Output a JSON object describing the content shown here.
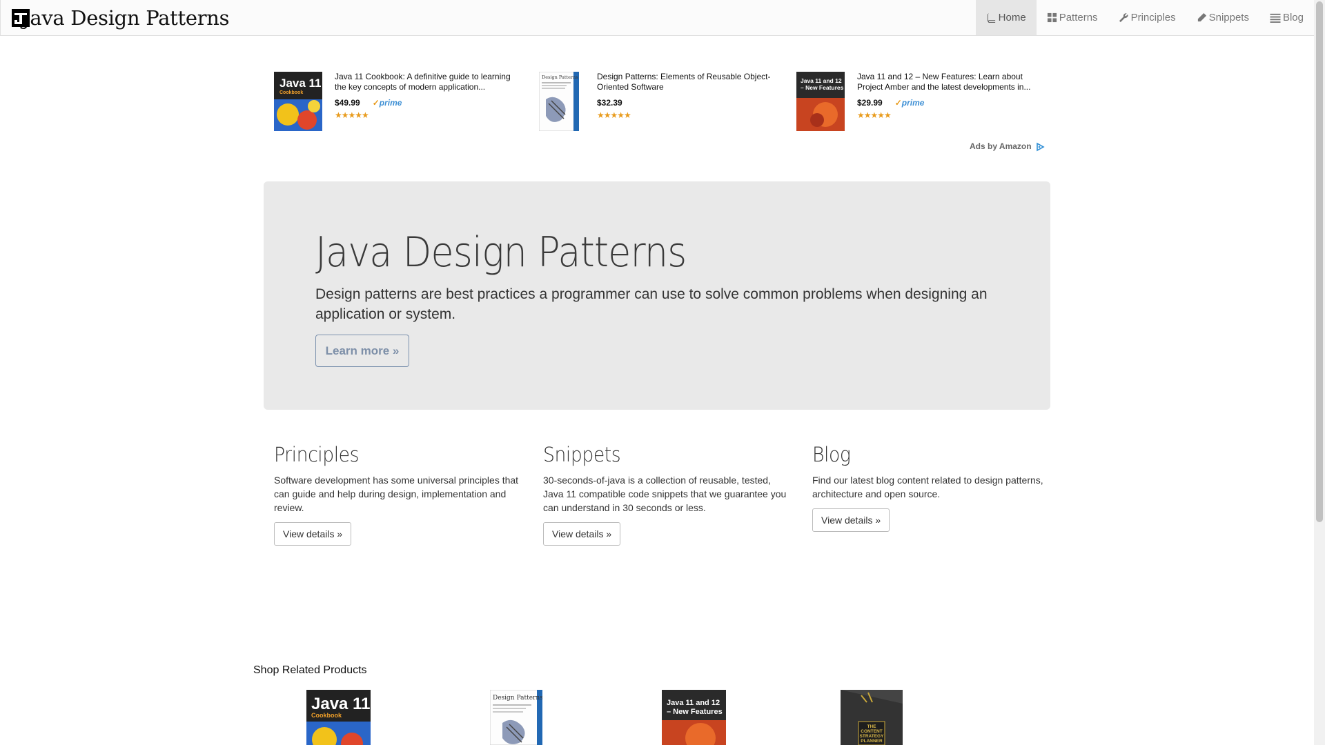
{
  "brand": {
    "title": "Java Design Patterns"
  },
  "nav": {
    "items": [
      {
        "label": "Home",
        "icon": "book-icon"
      },
      {
        "label": "Patterns",
        "icon": "grid-icon"
      },
      {
        "label": "Principles",
        "icon": "wrench-icon"
      },
      {
        "label": "Snippets",
        "icon": "pencil-icon"
      },
      {
        "label": "Blog",
        "icon": "list-icon"
      }
    ]
  },
  "ads": {
    "items": [
      {
        "cover_title": "Java 11",
        "cover_subtitle": "Cookbook",
        "title": "Java 11 Cookbook: A definitive guide to learning the key concepts of modern application...",
        "price": "$49.99",
        "prime": "prime",
        "rating": "★★★★★"
      },
      {
        "cover_title": "Design Patterns",
        "title": "Design Patterns: Elements of Reusable Object-Oriented Software",
        "price": "$32.39",
        "rating": "★★★★★"
      },
      {
        "cover_title": "Java 11 and 12",
        "cover_subtitle": "– New Features",
        "title": "Java 11 and 12 – New Features: Learn about Project Amber and the latest developments in...",
        "price": "$29.99",
        "prime": "prime",
        "rating": "★★★★★"
      }
    ],
    "ads_by": "Ads by Amazon"
  },
  "jumbotron": {
    "title": "Java Design Patterns",
    "text": "Design patterns are best practices a programmer can use to solve common problems when designing an application or system.",
    "button": "Learn more »"
  },
  "columns": [
    {
      "heading": "Principles",
      "text": "Software development has some universal principles that can guide and help during design, implementation and review.",
      "button": "View details »"
    },
    {
      "heading": "Snippets",
      "text": "30-seconds-of-java is a collection of reusable, tested, Java 11 compatible code snippets that we guarantee you can understand in 30 seconds or less.",
      "button": "View details »"
    },
    {
      "heading": "Blog",
      "text": "Find our latest blog content related to design patterns, architecture and open source.",
      "button": "View details »"
    }
  ],
  "shop": {
    "title": "Shop Related Products",
    "products": [
      {
        "cover_title": "Java 11",
        "cover_subtitle": "Cookbook"
      },
      {
        "cover_title": "Design Patterns"
      },
      {
        "cover_title": "Java 11 and 12",
        "cover_subtitle": "– New Features"
      },
      {
        "cover_title": "THE CONTENT STRATEGY PLANNER"
      }
    ]
  }
}
